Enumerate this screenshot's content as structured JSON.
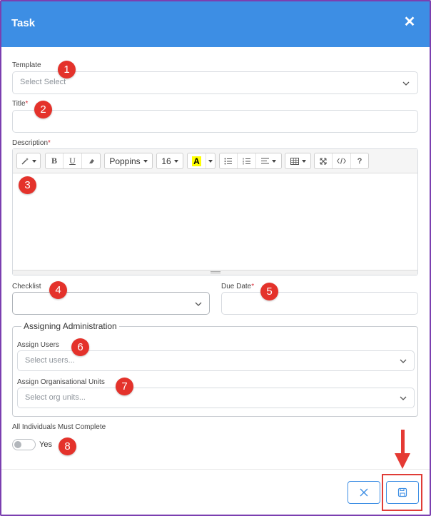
{
  "dialog": {
    "title": "Task"
  },
  "template": {
    "label": "Template",
    "placeholder": "Select Select"
  },
  "title_field": {
    "label": "Title",
    "required_mark": "*"
  },
  "description": {
    "label": "Description",
    "required_mark": "*",
    "toolbar": {
      "font_name": "Poppins",
      "font_size": "16",
      "bold": "B",
      "underline": "U",
      "color": "A",
      "help": "?"
    }
  },
  "checklist": {
    "label": "Checklist"
  },
  "due_date": {
    "label": "Due Date",
    "required_mark": "*"
  },
  "assigning": {
    "legend": "Assigning Administration",
    "users": {
      "label": "Assign Users",
      "placeholder": "Select users..."
    },
    "org_units": {
      "label": "Assign Organisational Units",
      "placeholder": "Select org units..."
    }
  },
  "individuals": {
    "label": "All Individuals Must Complete",
    "toggle_text": "Yes",
    "enabled": false
  },
  "badges": [
    "1",
    "2",
    "3",
    "4",
    "5",
    "6",
    "7",
    "8"
  ],
  "colors": {
    "header": "#3d8ee4",
    "badge": "#e4322b",
    "required": "#d9303a",
    "annotation": "#e53a34"
  },
  "icons": {
    "close": "close-icon",
    "cancel": "x-icon",
    "save": "floppy-disk-icon"
  }
}
